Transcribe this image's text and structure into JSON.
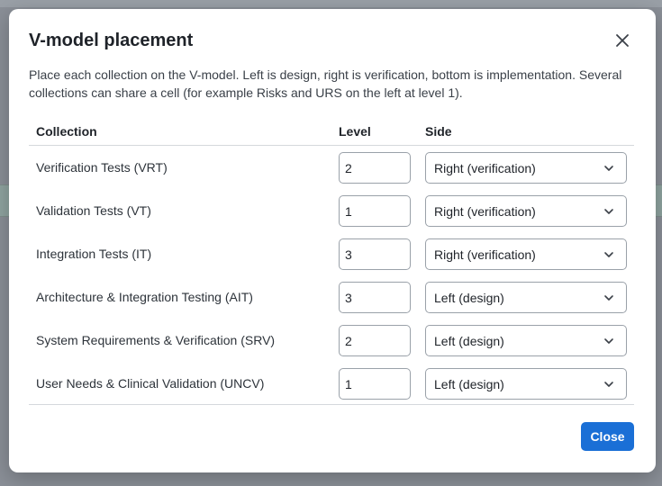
{
  "dialog": {
    "title": "V-model placement",
    "description": "Place each collection on the V-model. Left is design, right is verification, bottom is implementation. Several collections can share a cell (for example Risks and URS on the left at level 1).",
    "close_icon": "close-icon",
    "close_label": "Close"
  },
  "table": {
    "headers": {
      "collection": "Collection",
      "level": "Level",
      "side": "Side"
    },
    "rows": [
      {
        "collection": "Verification Tests (VRT)",
        "level": "2",
        "side": "Right (verification)"
      },
      {
        "collection": "Validation Tests (VT)",
        "level": "1",
        "side": "Right (verification)"
      },
      {
        "collection": "Integration Tests (IT)",
        "level": "3",
        "side": "Right (verification)"
      },
      {
        "collection": "Architecture & Integration Testing (AIT)",
        "level": "3",
        "side": "Left (design)"
      },
      {
        "collection": "System Requirements & Verification (SRV)",
        "level": "2",
        "side": "Left (design)"
      },
      {
        "collection": "User Needs & Clinical Validation (UNCV)",
        "level": "1",
        "side": "Left (design)"
      }
    ]
  },
  "colors": {
    "primary": "#1a6fd6",
    "overlay": "#8a8f97"
  }
}
